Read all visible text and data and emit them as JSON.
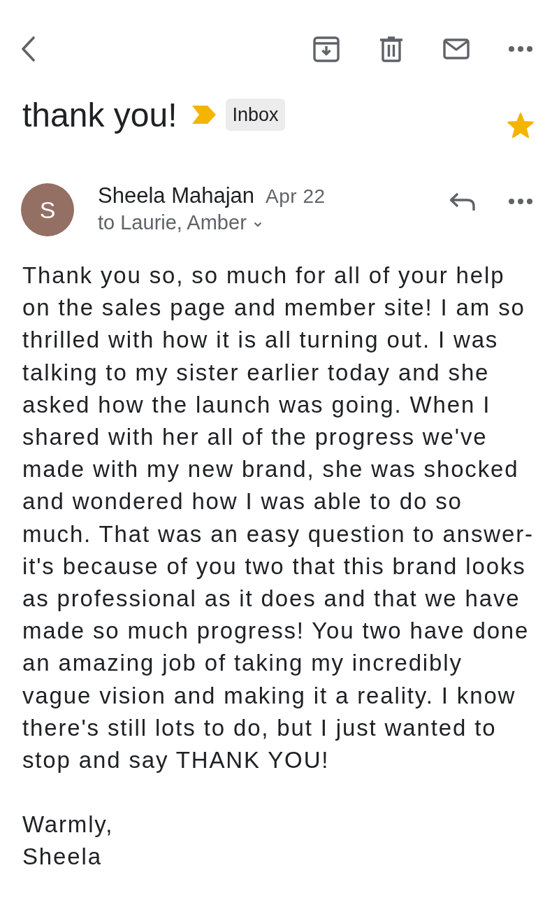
{
  "subject": {
    "title": "thank you!",
    "important": true,
    "labels": [
      "Inbox"
    ],
    "starred": true
  },
  "message": {
    "initial": "S",
    "sender": "Sheela Mahajan",
    "date": "Apr 22",
    "recipients": "to Laurie, Amber"
  },
  "body": {
    "paragraphs": [
      {
        "lines": [
          "Thank you so, so much for all of your help",
          "on the sales page and member site! I am so",
          "thrilled with how it is all turning out. I was",
          "talking to my sister earlier today and she",
          "asked how the launch was going. When I",
          "shared with her all of the progress we've",
          "made with my new brand, she was shocked",
          "and wondered how I was able to do so",
          "much. That was an easy question to answer-",
          "it's because of you two that this brand looks",
          "as professional as it does and that we have",
          "made so much progress! You two have done",
          "an amazing job of taking my incredibly",
          "vague vision and making it a reality. I know",
          "there's still lots to do, but I just wanted to",
          "stop and say THANK YOU!"
        ]
      },
      {
        "lines": [
          "Warmly,",
          "Sheela"
        ]
      }
    ]
  }
}
